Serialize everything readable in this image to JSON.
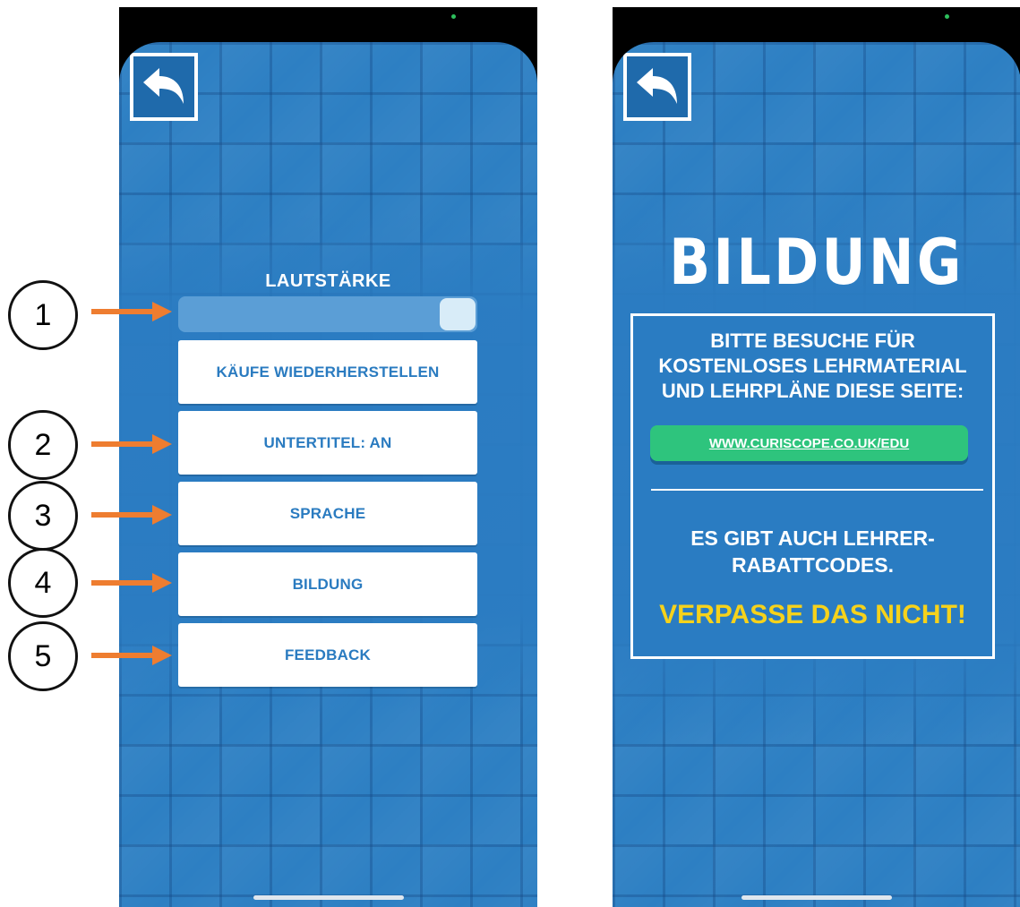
{
  "settings_screen": {
    "volume_label": "LAUTSTÄRKE",
    "volume_level_percent": 100,
    "buttons": {
      "restore_purchases": "KÄUFE WIEDERHERSTELLEN",
      "subtitles": "UNTERTITEL: AN",
      "language": "SPRACHE",
      "education": "BILDUNG",
      "feedback": "FEEDBACK"
    }
  },
  "annotations": {
    "labels": [
      "1",
      "2",
      "3",
      "4",
      "5"
    ],
    "arrow_color": "#ee7d30"
  },
  "education_screen": {
    "title": "BILDUNG",
    "info": "BITTE BESUCHE FÜR KOSTENLOSES LEHRMATERIAL UND LEHRPLÄNE DIESE SEITE:",
    "link": "WWW.CURISCOPE.CO.UK/EDU",
    "teacher_note": "ES GIBT AUCH LEHRER-RABATTCODES.",
    "warning": "VERPASSE DAS NICHT!"
  },
  "colors": {
    "screen_blue": "#2d7fc3",
    "button_text_blue": "#2a7bc0",
    "link_green": "#2ec47d",
    "warning_yellow": "#f6d21b"
  },
  "icons": {
    "back": "back-arrow-icon"
  }
}
